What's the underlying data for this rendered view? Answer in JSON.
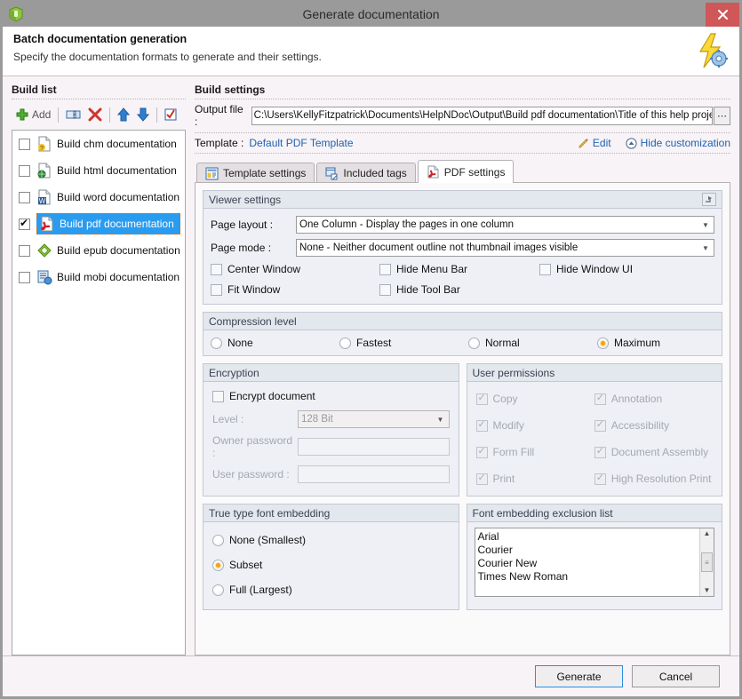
{
  "window": {
    "title": "Generate documentation",
    "app_icon": "helpndoc-cube-icon",
    "close_label": "×"
  },
  "header": {
    "title": "Batch documentation generation",
    "subtitle": "Specify the documentation formats to generate and their settings.",
    "icon": "lightning-gear-icon"
  },
  "build_list": {
    "panel_title": "Build list",
    "toolbar": {
      "add_label": "Add",
      "buttons": [
        {
          "name": "add-button",
          "icon": "plus-icon",
          "label": "Add"
        },
        {
          "name": "duplicate-button",
          "icon": "duplicate-icon",
          "label": ""
        },
        {
          "name": "delete-button",
          "icon": "red-x-icon",
          "label": ""
        },
        {
          "name": "move-up-button",
          "icon": "arrow-up-icon",
          "label": ""
        },
        {
          "name": "move-down-button",
          "icon": "arrow-down-icon",
          "label": ""
        },
        {
          "name": "toggle-all-button",
          "icon": "check-all-icon",
          "label": ""
        }
      ]
    },
    "items": [
      {
        "label": "Build chm documentation",
        "checked": false,
        "selected": false,
        "icon": "chm-file-icon"
      },
      {
        "label": "Build html documentation",
        "checked": false,
        "selected": false,
        "icon": "html-file-icon"
      },
      {
        "label": "Build word documentation",
        "checked": false,
        "selected": false,
        "icon": "word-file-icon"
      },
      {
        "label": "Build pdf documentation",
        "checked": true,
        "selected": true,
        "icon": "pdf-file-icon"
      },
      {
        "label": "Build epub documentation",
        "checked": false,
        "selected": false,
        "icon": "epub-file-icon"
      },
      {
        "label": "Build mobi documentation",
        "checked": false,
        "selected": false,
        "icon": "mobi-file-icon"
      }
    ]
  },
  "build_settings": {
    "panel_title": "Build settings",
    "output_file": {
      "label": "Output file :",
      "value": "C:\\Users\\KellyFitzpatrick\\Documents\\HelpNDoc\\Output\\Build pdf documentation\\Title of this help project.pdf",
      "browse_label": "⋯"
    },
    "template": {
      "label": "Template :",
      "value": "Default PDF Template",
      "edit_label": "Edit",
      "hide_customization_label": "Hide customization"
    },
    "tabs": [
      {
        "label": "Template settings",
        "icon": "template-settings-icon",
        "active": false
      },
      {
        "label": "Included tags",
        "icon": "tags-icon",
        "active": false
      },
      {
        "label": "PDF settings",
        "icon": "pdf-icon",
        "active": true
      }
    ]
  },
  "viewer_settings": {
    "title": "Viewer settings",
    "collapse_icon": "collapse-icon",
    "page_layout": {
      "label": "Page layout :",
      "value": "One Column - Display the pages in one column"
    },
    "page_mode": {
      "label": "Page mode :",
      "value": "None - Neither document outline not thumbnail images visible"
    },
    "checkboxes": [
      {
        "label": "Center Window",
        "checked": false
      },
      {
        "label": "Hide Menu Bar",
        "checked": false
      },
      {
        "label": "Hide Window UI",
        "checked": false
      },
      {
        "label": "Fit Window",
        "checked": false
      },
      {
        "label": "Hide Tool Bar",
        "checked": false
      }
    ]
  },
  "compression": {
    "title": "Compression level",
    "options": [
      {
        "label": "None",
        "selected": false
      },
      {
        "label": "Fastest",
        "selected": false
      },
      {
        "label": "Normal",
        "selected": false
      },
      {
        "label": "Maximum",
        "selected": true
      }
    ]
  },
  "encryption": {
    "title": "Encryption",
    "encrypt_document": {
      "label": "Encrypt document",
      "checked": false
    },
    "level": {
      "label": "Level :",
      "value": "128 Bit",
      "disabled": true
    },
    "owner_password": {
      "label": "Owner password :",
      "value": "",
      "disabled": true
    },
    "user_password": {
      "label": "User password :",
      "value": "",
      "disabled": true
    }
  },
  "user_permissions": {
    "title": "User permissions",
    "left": [
      {
        "label": "Copy",
        "checked": true,
        "disabled": true
      },
      {
        "label": "Modify",
        "checked": true,
        "disabled": true
      },
      {
        "label": "Form Fill",
        "checked": true,
        "disabled": true
      },
      {
        "label": "Print",
        "checked": true,
        "disabled": true
      }
    ],
    "right": [
      {
        "label": "Annotation",
        "checked": true,
        "disabled": true
      },
      {
        "label": "Accessibility",
        "checked": true,
        "disabled": true
      },
      {
        "label": "Document Assembly",
        "checked": true,
        "disabled": true
      },
      {
        "label": "High Resolution Print",
        "checked": true,
        "disabled": true
      }
    ]
  },
  "font_embedding": {
    "title": "True type font embedding",
    "options": [
      {
        "label": "None (Smallest)",
        "selected": false
      },
      {
        "label": "Subset",
        "selected": true
      },
      {
        "label": "Full (Largest)",
        "selected": false
      }
    ]
  },
  "font_exclusion": {
    "title": "Font embedding exclusion list",
    "items": [
      "Arial",
      "Courier",
      "Courier New",
      "Times New Roman"
    ],
    "scroll_up": "▲",
    "scroll_down": "▼",
    "thumb": "≡"
  },
  "footer": {
    "generate_label": "Generate",
    "cancel_label": "Cancel"
  },
  "colors": {
    "accent": "#2a9cf0",
    "link": "#2063b0",
    "radio_on": "#f5a700",
    "close": "#cf5757",
    "titlebar": "#9a9a9a"
  }
}
